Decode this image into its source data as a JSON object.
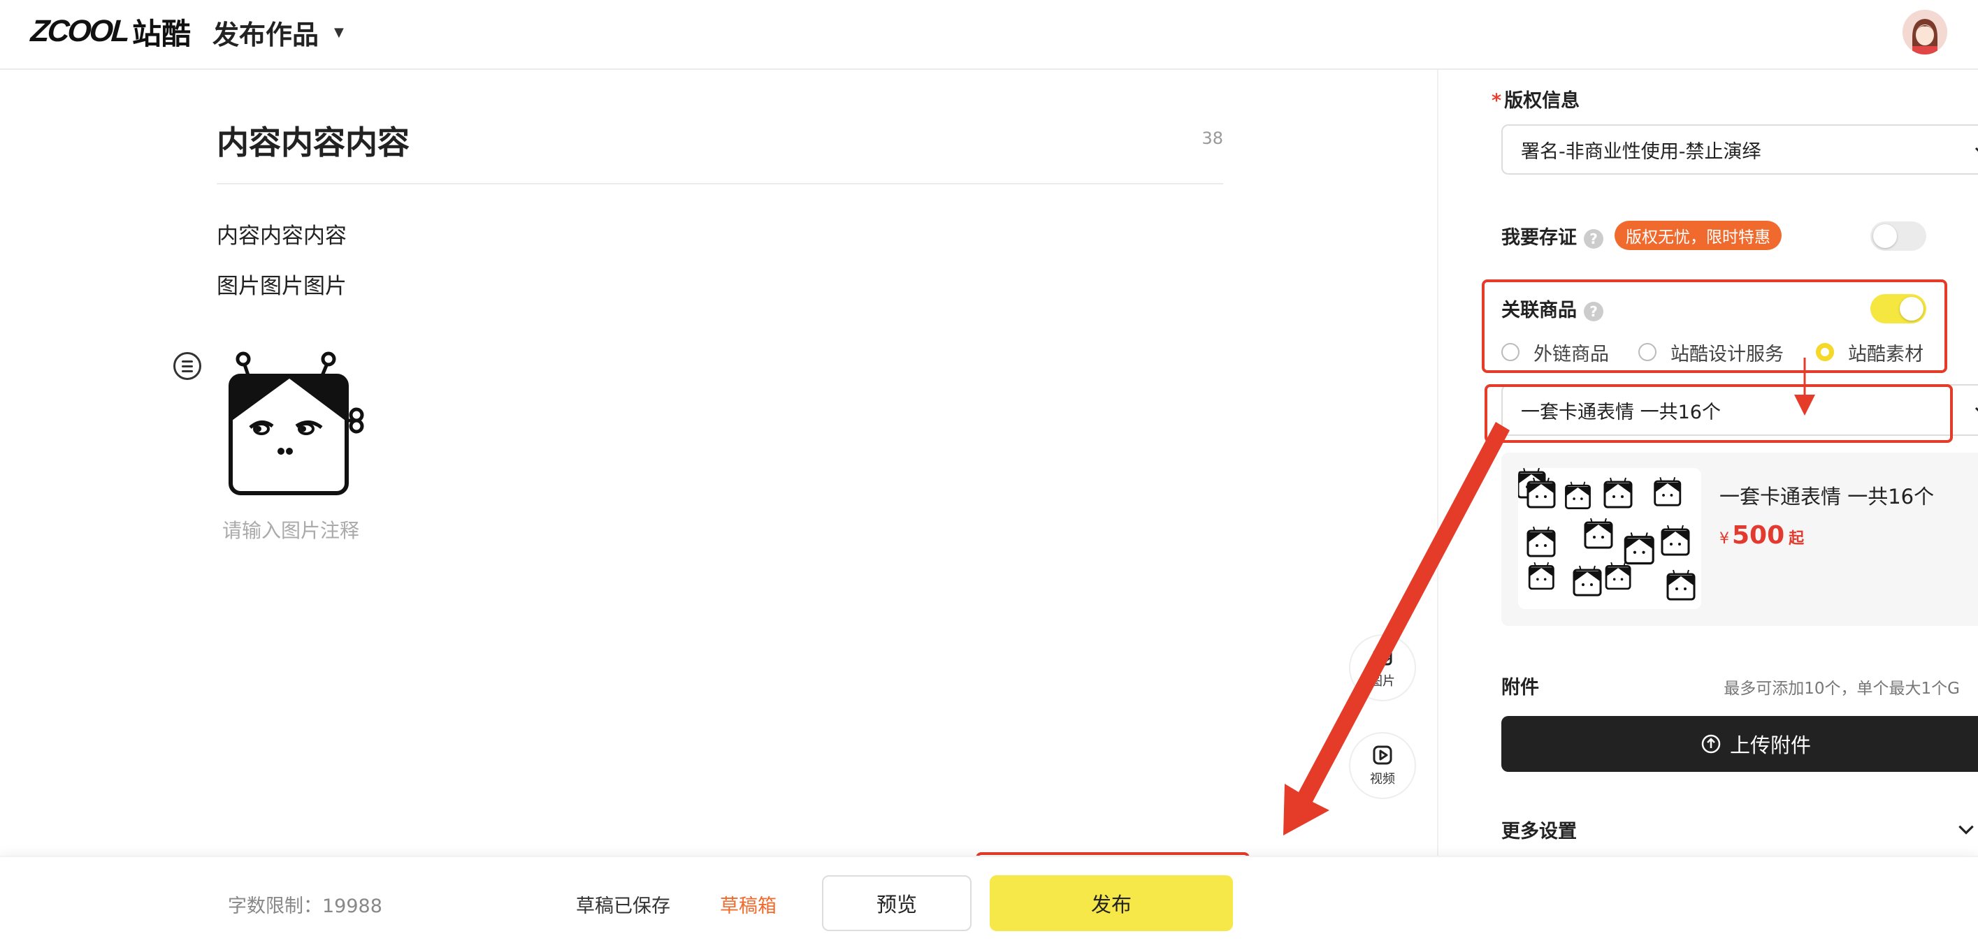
{
  "header": {
    "logo_en": "ZCOOL",
    "logo_cn": "站酷",
    "page_title": "发布作品"
  },
  "editor": {
    "title": "内容内容内容",
    "title_count": "38",
    "paragraphs": [
      "内容内容内容",
      "图片图片图片"
    ],
    "image_caption_placeholder": "请输入图片注释",
    "tools": {
      "image_label": "图片",
      "video_label": "视频"
    }
  },
  "panel": {
    "copyright": {
      "label": "版权信息",
      "required_mark": "*",
      "selected": "署名-非商业性使用-禁止演绎"
    },
    "certificate": {
      "label": "我要存证",
      "help": "?",
      "promo": "版权无忧，限时特惠",
      "enabled": false
    },
    "linked_product": {
      "label": "关联商品",
      "help": "?",
      "enabled": true,
      "options": [
        "外链商品",
        "站酷设计服务",
        "站酷素材"
      ],
      "selected_option_index": 2,
      "selected_product": "一套卡通表情 一共16个"
    },
    "product_card": {
      "name": "一套卡通表情 一共16个",
      "currency": "¥",
      "price": "500",
      "price_suffix": "起"
    },
    "attachment": {
      "label": "附件",
      "hint": "最多可添加10个，单个最大1个G",
      "upload_label": "上传附件"
    },
    "more_settings": {
      "label": "更多设置"
    }
  },
  "footer": {
    "word_limit": "字数限制：19988",
    "draft_saved": "草稿已保存",
    "drafts": "草稿箱",
    "preview": "预览",
    "publish": "发布"
  },
  "colors": {
    "accent_yellow": "#f7e84a",
    "promo_orange": "#f06a2d",
    "annotation_red": "#e53c2a",
    "price_red": "#e23a2e"
  }
}
